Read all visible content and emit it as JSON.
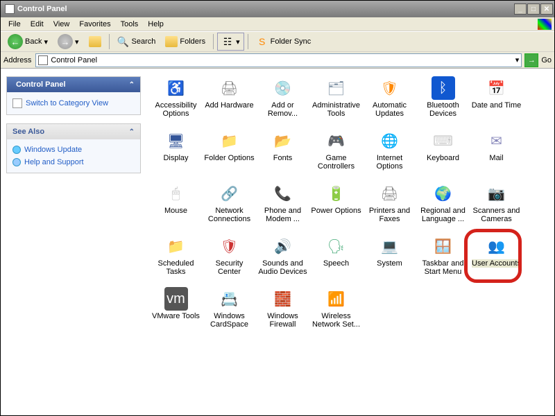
{
  "window": {
    "title": "Control Panel"
  },
  "menubar": {
    "file": "File",
    "edit": "Edit",
    "view": "View",
    "favorites": "Favorites",
    "tools": "Tools",
    "help": "Help"
  },
  "toolbar": {
    "back": "Back",
    "search": "Search",
    "folders": "Folders",
    "foldersync": "Folder Sync"
  },
  "addressbar": {
    "label": "Address",
    "value": "Control Panel",
    "go": "Go"
  },
  "sidebar": {
    "panel1": {
      "title": "Control Panel",
      "link1": "Switch to Category View"
    },
    "panel2": {
      "title": "See Also",
      "link1": "Windows Update",
      "link2": "Help and Support"
    }
  },
  "items": [
    {
      "label": "Accessibility Options",
      "icon": "wheelchair-icon",
      "cls": "ic-wheel",
      "glyph": "♿"
    },
    {
      "label": "Add Hardware",
      "icon": "hardware-icon",
      "cls": "ic-card",
      "glyph": "🖨"
    },
    {
      "label": "Add or Remov...",
      "icon": "add-remove-icon",
      "cls": "ic-cd",
      "glyph": "💿"
    },
    {
      "label": "Administrative Tools",
      "icon": "admin-tools-icon",
      "cls": "ic-tools",
      "glyph": "🗂"
    },
    {
      "label": "Automatic Updates",
      "icon": "updates-icon",
      "cls": "ic-update",
      "glyph": "🛡"
    },
    {
      "label": "Bluetooth Devices",
      "icon": "bluetooth-icon",
      "cls": "ic-bt",
      "glyph": "ᛒ"
    },
    {
      "label": "Date and Time",
      "icon": "datetime-icon",
      "cls": "ic-time",
      "glyph": "📅"
    },
    {
      "label": "Display",
      "icon": "display-icon",
      "cls": "ic-disp",
      "glyph": "🖥"
    },
    {
      "label": "Folder Options",
      "icon": "folder-options-icon",
      "cls": "ic-folder",
      "glyph": "📁"
    },
    {
      "label": "Fonts",
      "icon": "fonts-icon",
      "cls": "ic-fonts",
      "glyph": "📂"
    },
    {
      "label": "Game Controllers",
      "icon": "game-icon",
      "cls": "ic-game",
      "glyph": "🎮"
    },
    {
      "label": "Internet Options",
      "icon": "internet-icon",
      "cls": "ic-inet",
      "glyph": "🌐"
    },
    {
      "label": "Keyboard",
      "icon": "keyboard-icon",
      "cls": "ic-key",
      "glyph": "⌨"
    },
    {
      "label": "Mail",
      "icon": "mail-icon",
      "cls": "ic-mail",
      "glyph": "✉"
    },
    {
      "label": "Mouse",
      "icon": "mouse-icon",
      "cls": "ic-mouse",
      "glyph": "🖱"
    },
    {
      "label": "Network Connections",
      "icon": "network-icon",
      "cls": "ic-net",
      "glyph": "🔗"
    },
    {
      "label": "Phone and Modem ...",
      "icon": "phone-icon",
      "cls": "ic-phone",
      "glyph": "📞"
    },
    {
      "label": "Power Options",
      "icon": "power-icon",
      "cls": "ic-power",
      "glyph": "🔋"
    },
    {
      "label": "Printers and Faxes",
      "icon": "printers-icon",
      "cls": "ic-print",
      "glyph": "🖨"
    },
    {
      "label": "Regional and Language ...",
      "icon": "regional-icon",
      "cls": "ic-region",
      "glyph": "🌍"
    },
    {
      "label": "Scanners and Cameras",
      "icon": "scanners-icon",
      "cls": "ic-scan",
      "glyph": "📷"
    },
    {
      "label": "Scheduled Tasks",
      "icon": "scheduled-icon",
      "cls": "ic-sched",
      "glyph": "📁"
    },
    {
      "label": "Security Center",
      "icon": "security-icon",
      "cls": "ic-sec",
      "glyph": "🛡"
    },
    {
      "label": "Sounds and Audio Devices",
      "icon": "sound-icon",
      "cls": "ic-sound",
      "glyph": "🔊"
    },
    {
      "label": "Speech",
      "icon": "speech-icon",
      "cls": "ic-speech",
      "glyph": "🗣"
    },
    {
      "label": "System",
      "icon": "system-icon",
      "cls": "ic-system",
      "glyph": "💻"
    },
    {
      "label": "Taskbar and Start Menu",
      "icon": "taskbar-icon",
      "cls": "ic-taskbar",
      "glyph": "🪟"
    },
    {
      "label": "User Accounts",
      "icon": "user-accounts-icon",
      "cls": "ic-users",
      "glyph": "👥",
      "highlighted": true
    },
    {
      "label": "VMware Tools",
      "icon": "vmware-icon",
      "cls": "ic-vmware",
      "glyph": "vm"
    },
    {
      "label": "Windows CardSpace",
      "icon": "cardspace-icon",
      "cls": "ic-cardspace",
      "glyph": "📇"
    },
    {
      "label": "Windows Firewall",
      "icon": "firewall-icon",
      "cls": "ic-firewall",
      "glyph": "🧱"
    },
    {
      "label": "Wireless Network Set...",
      "icon": "wireless-icon",
      "cls": "ic-wifi",
      "glyph": "📶"
    }
  ]
}
